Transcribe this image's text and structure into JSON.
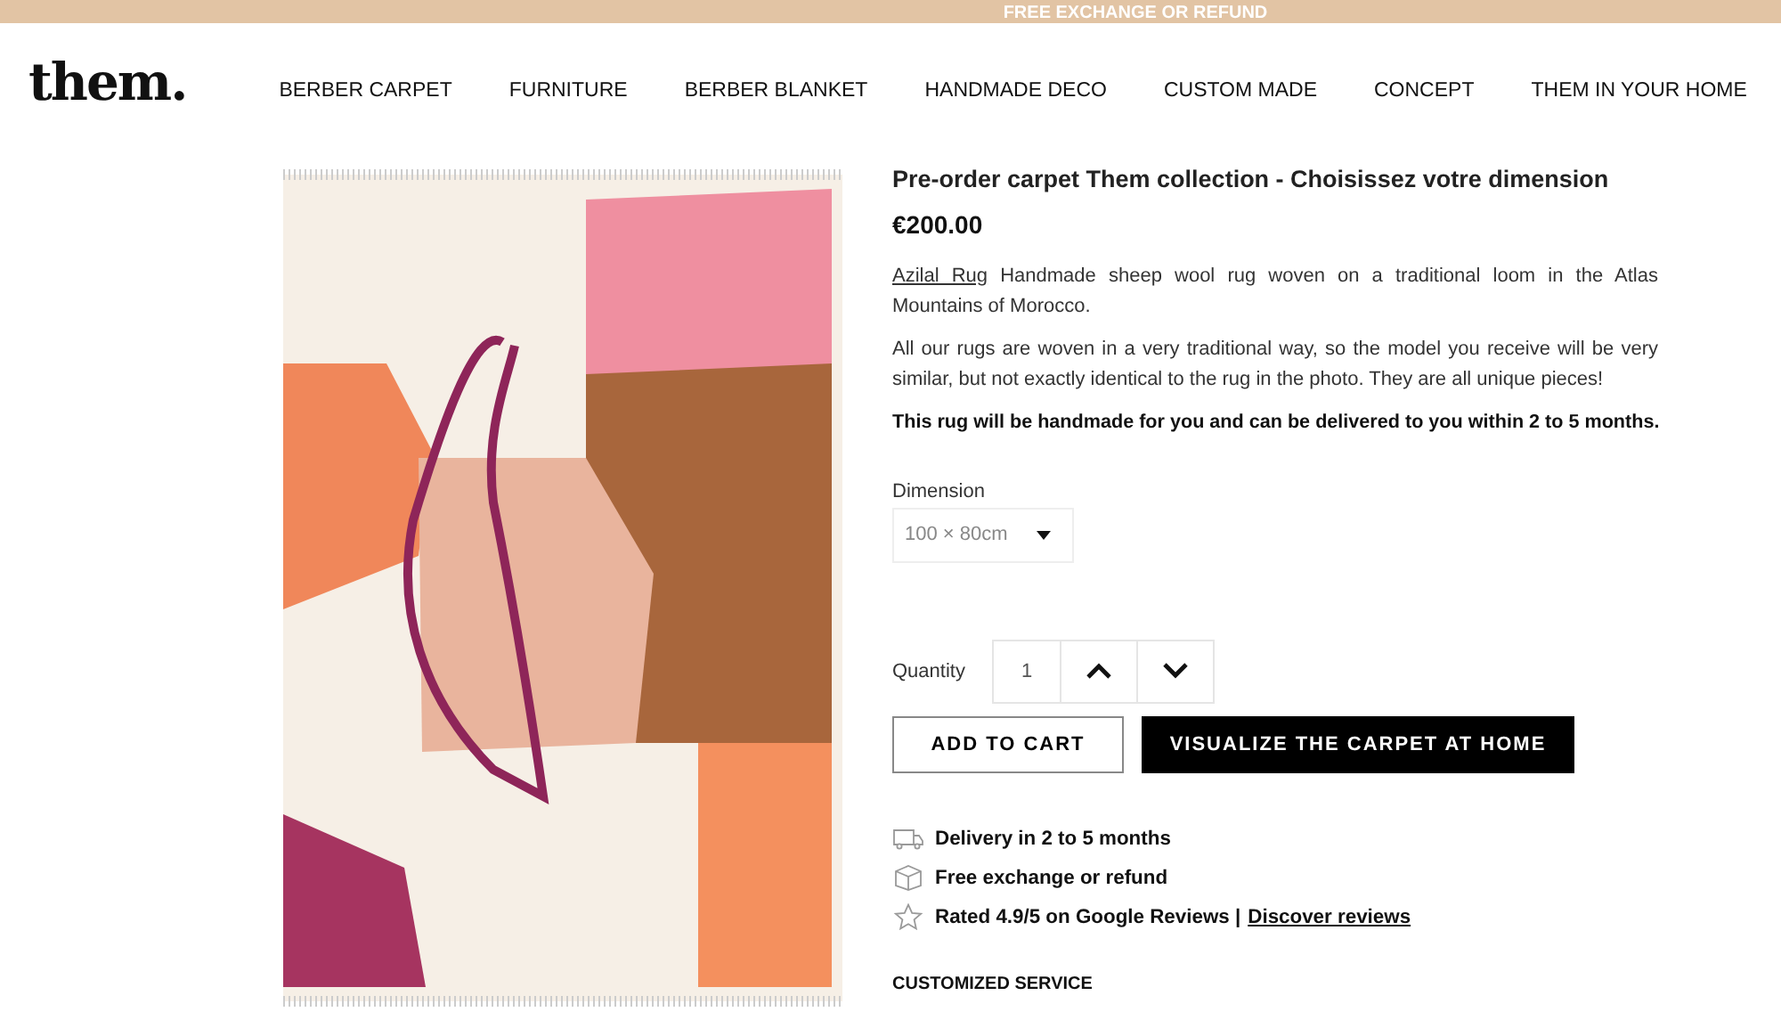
{
  "banner": {
    "text": "FREE EXCHANGE OR REFUND"
  },
  "logo": "them.",
  "nav": [
    {
      "label": "BERBER CARPET"
    },
    {
      "label": "FURNITURE"
    },
    {
      "label": "BERBER BLANKET"
    },
    {
      "label": "HANDMADE DECO"
    },
    {
      "label": "CUSTOM MADE"
    },
    {
      "label": "CONCEPT"
    },
    {
      "label": "THEM IN YOUR HOME"
    }
  ],
  "product": {
    "title": "Pre-order carpet Them collection - Choisissez votre dimension",
    "price": "€200.00",
    "intro": {
      "link": "Azilal Rug",
      "text": " Handmade sheep wool rug woven on a traditional loom in the Atlas Mountains of Morocco."
    },
    "description": "All our rugs are woven in a very traditional way, so the model you receive will be very similar, but not exactly identical to the rug in the photo. They are all unique pieces!",
    "notice": "This rug will be handmade for you and can be delivered to you within 2 to 5 months.",
    "dimension": {
      "label": "Dimension",
      "value": "100 × 80cm"
    },
    "quantity": {
      "label": "Quantity",
      "value": "1"
    },
    "buttons": [
      {
        "kind": "outline",
        "label": "ADD TO CART"
      },
      {
        "kind": "solid",
        "label": "VISUALIZE THE CARPET AT HOME"
      }
    ],
    "features": [
      {
        "kind": "truck",
        "text": "Delivery in 2 to 5 months"
      },
      {
        "kind": "box",
        "text": "Free exchange or refund"
      },
      {
        "kind": "star",
        "text": "Rated 4.9/5 on Google Reviews |",
        "link": "Discover reviews"
      }
    ],
    "section_heading": "CUSTOMIZED SERVICE"
  }
}
